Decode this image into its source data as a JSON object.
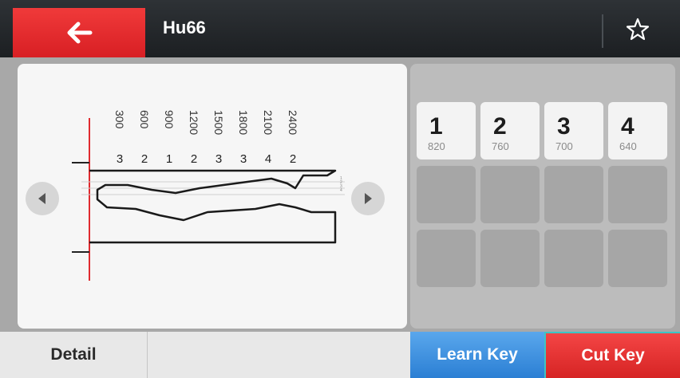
{
  "header": {
    "title": "Hu66",
    "back_icon": "arrow-left-icon",
    "favorite_icon": "star-outline-icon"
  },
  "key_diagram": {
    "positions": [
      "300",
      "600",
      "900",
      "1200",
      "1500",
      "1800",
      "2100",
      "2400"
    ],
    "depths": [
      "3",
      "2",
      "1",
      "2",
      "3",
      "3",
      "4",
      "2"
    ],
    "side_marker": "1\n2\n3\n4"
  },
  "depth_table": [
    {
      "depth": "1",
      "value": "820"
    },
    {
      "depth": "2",
      "value": "760"
    },
    {
      "depth": "3",
      "value": "700"
    },
    {
      "depth": "4",
      "value": "640"
    }
  ],
  "footer": {
    "detail_label": "Detail",
    "learn_label": "Learn Key",
    "cut_label": "Cut Key"
  },
  "colors": {
    "accent_red": "#e02b2f",
    "learn_blue": "#3a8fe0",
    "cut_outline": "#3fc4c4"
  }
}
